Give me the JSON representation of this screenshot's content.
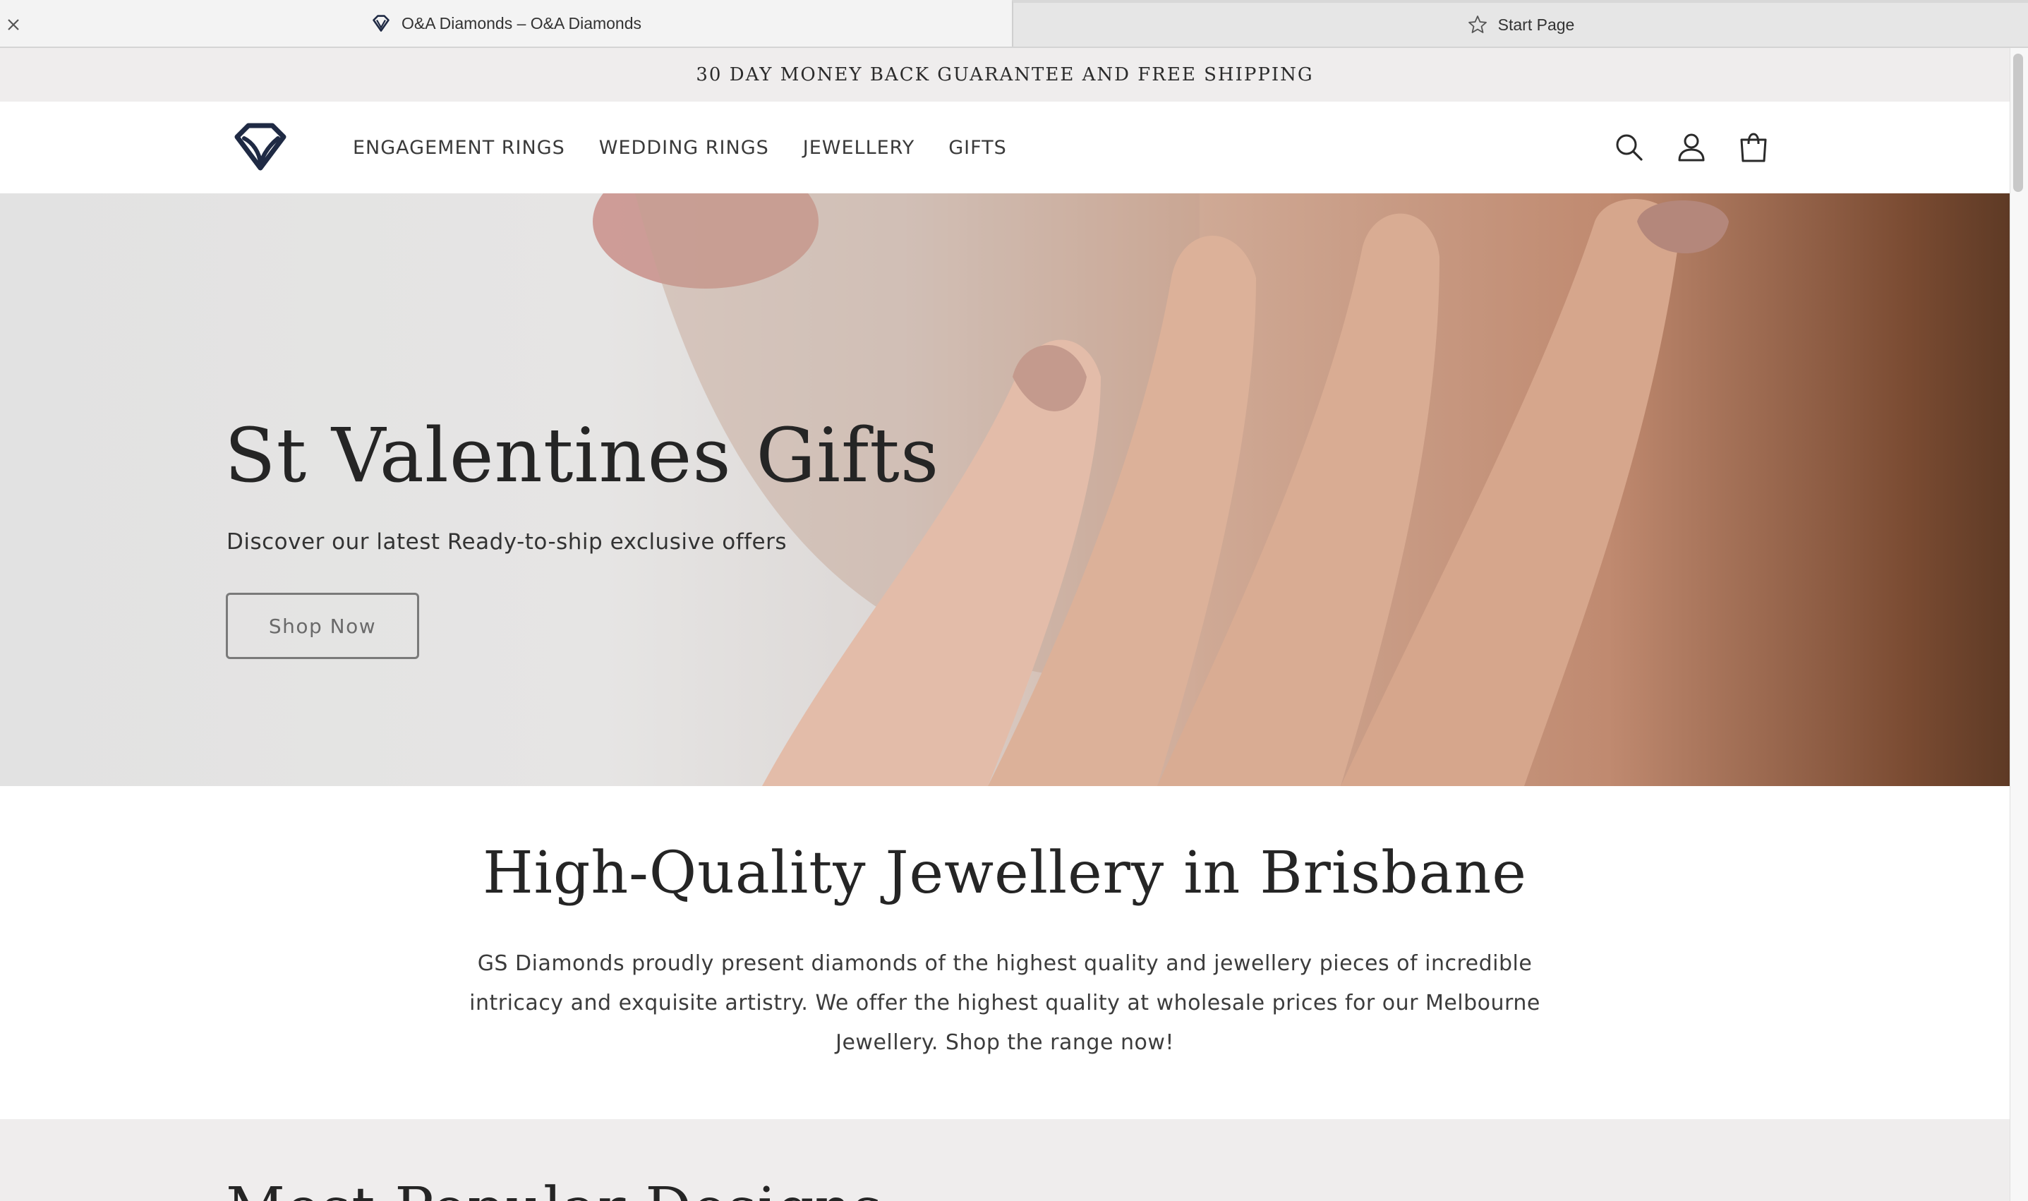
{
  "browser": {
    "tabs": [
      {
        "title": "O&A Diamonds – O&A Diamonds",
        "active": true,
        "icon": "diamond-favicon-icon"
      },
      {
        "title": "Start Page",
        "active": false,
        "icon": "star-icon"
      }
    ]
  },
  "announcement": {
    "text": "30 DAY MONEY BACK GUARANTEE AND FREE SHIPPING"
  },
  "header": {
    "logo_icon": "diamond-logo-icon",
    "nav": [
      "ENGAGEMENT RINGS",
      "WEDDING RINGS",
      "JEWELLERY",
      "GIFTS"
    ],
    "icons": [
      "search-icon",
      "account-icon",
      "cart-icon"
    ]
  },
  "hero": {
    "title": "St Valentines Gifts",
    "subtitle": "Discover our latest Ready-to-ship exclusive offers",
    "button": "Shop Now"
  },
  "intro": {
    "title": "High-Quality Jewellery in Brisbane",
    "body": "GS Diamonds proudly present diamonds of the highest quality and jewellery pieces of incredible intricacy and exquisite artistry. We offer the highest quality at wholesale prices for our Melbourne Jewellery. Shop the range now!"
  },
  "next_section": {
    "title": "Most Popular Designs"
  },
  "colors": {
    "accent": "#1f2a44",
    "announcement_bg": "#efeded",
    "text": "#252525"
  }
}
